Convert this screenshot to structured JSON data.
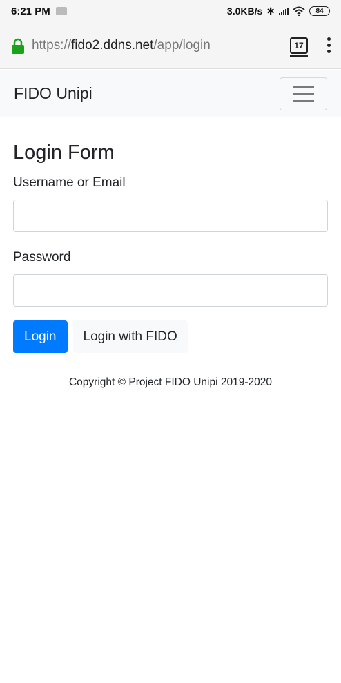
{
  "status_bar": {
    "time": "6:21 PM",
    "network_speed": "3.0KB/s",
    "battery": "84",
    "icons": [
      "notification-icon",
      "bluetooth-icon",
      "signal-icon",
      "wifi-icon",
      "battery-icon"
    ]
  },
  "browser": {
    "url_scheme": "https://",
    "url_host": "fido2.ddns.net",
    "url_path": "/app/login",
    "tab_count": "17",
    "lock_color": "#1aa21a"
  },
  "navbar": {
    "brand": "FIDO Unipi"
  },
  "form": {
    "title": "Login Form",
    "username_label": "Username or Email",
    "username_value": "",
    "username_placeholder": "",
    "password_label": "Password",
    "password_value": "",
    "password_placeholder": "",
    "login_button": "Login",
    "fido_button": "Login with FIDO"
  },
  "footer": {
    "copyright": "Copyright © Project FIDO Unipi 2019-2020"
  },
  "colors": {
    "primary": "#007bff",
    "navbar_bg": "#f8f9fa"
  }
}
